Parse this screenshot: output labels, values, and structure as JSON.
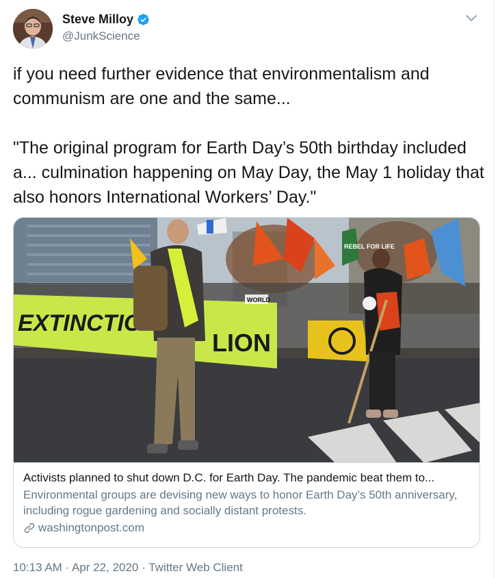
{
  "author": {
    "display_name": "Steve Milloy",
    "handle": "@JunkScience",
    "verified": true
  },
  "icons": {
    "verified": "verified-badge-icon",
    "caret": "chevron-down-icon",
    "link": "link-icon"
  },
  "tweet": {
    "text": "if you need further evidence that environmentalism and communism are one and the same...\n\n\"The original program for Earth Day’s 50th birthday included a... culmination happening on May Day, the May 1 holiday that also honors International Workers’ Day.\""
  },
  "card": {
    "image_banners": {
      "main_banner_left": "EXTINCTION",
      "main_banner_right": "LION",
      "small_sign": "WORLD",
      "flag_sign": "REBEL FOR LIFE"
    },
    "title": "Activists planned to shut down D.C. for Earth Day. The pandemic beat them to...",
    "description": "Environmental groups are devising new ways to honor Earth Day’s 50th anniversary, including rogue gardening and socially distant protests.",
    "domain": "washingtonpost.com"
  },
  "meta": {
    "time": "10:13 AM",
    "separator": "·",
    "date": "Apr 22, 2020",
    "client": "Twitter Web Client"
  },
  "colors": {
    "verified_blue": "#1da1f2",
    "secondary_text": "#657786",
    "banner_green": "#c8e84a",
    "flag_orange": "#e2541b"
  }
}
